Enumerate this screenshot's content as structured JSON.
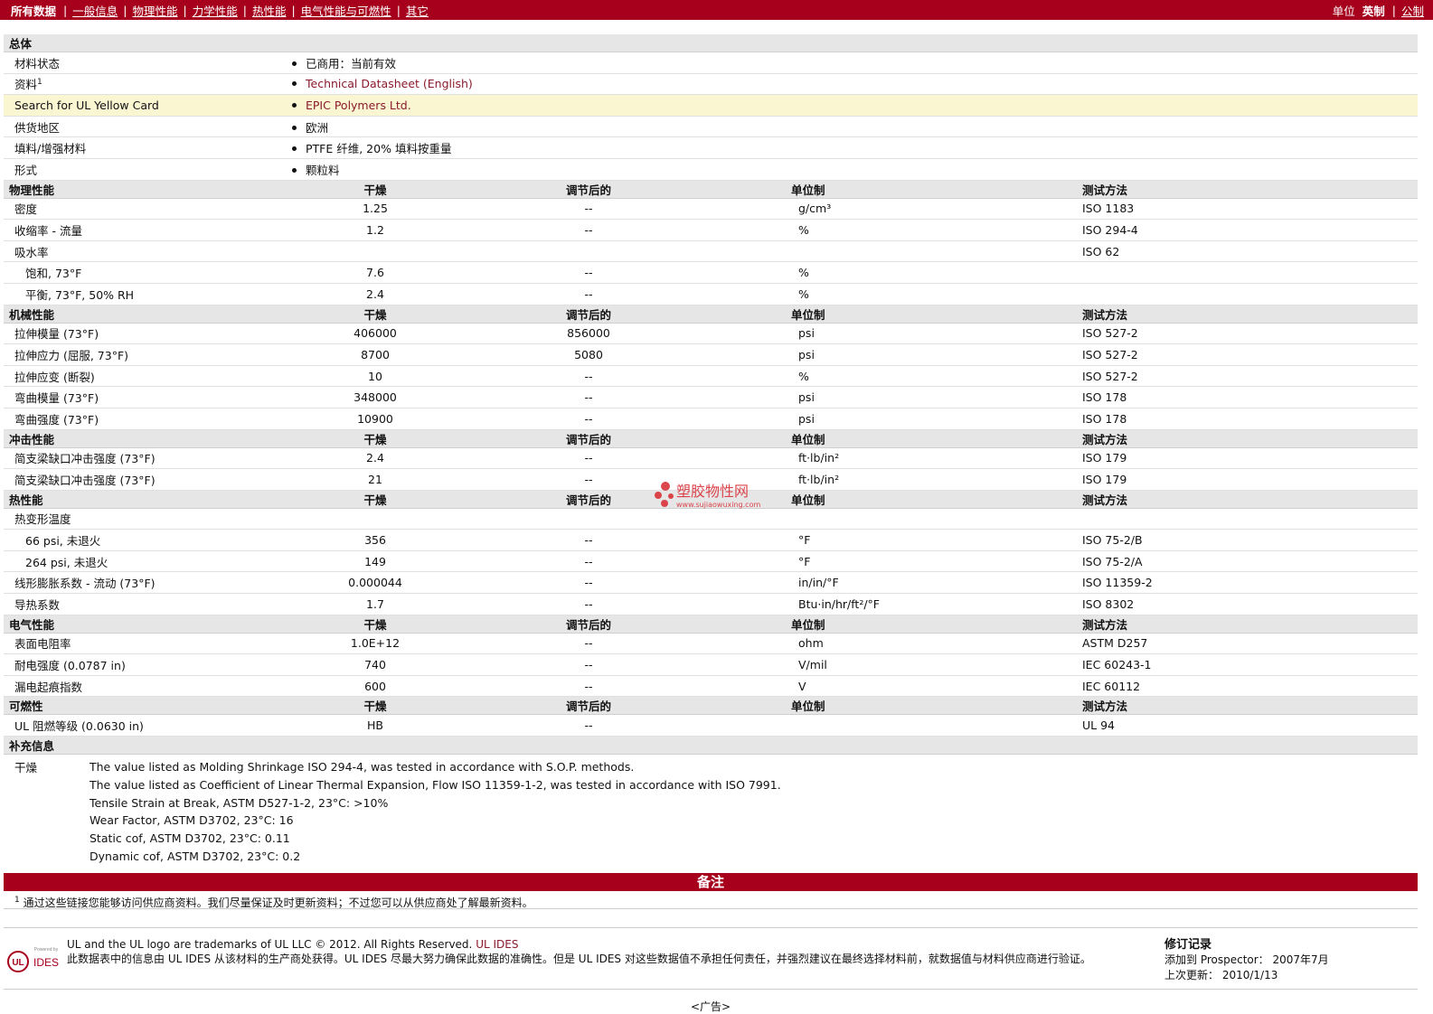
{
  "nav": {
    "current": "所有数据",
    "items": [
      "一般信息",
      "物理性能",
      "力学性能",
      "热性能",
      "电气性能与可燃性",
      "其它"
    ],
    "units_label": "单位",
    "unit_english": "英制",
    "unit_metric": "公制"
  },
  "general": {
    "title": "总体",
    "rows": [
      {
        "label": "材料状态",
        "value": "已商用：当前有效"
      },
      {
        "label": "资料",
        "value": "Technical Datasheet (English)"
      },
      {
        "label": "Search for UL Yellow Card",
        "value": "EPIC Polymers Ltd."
      },
      {
        "label": "供货地区",
        "value": "欧洲"
      },
      {
        "label": "填料/增强材料",
        "value": "PTFE 纤维, 20% 填料按重量"
      },
      {
        "label": "形式",
        "value": "颗粒料"
      }
    ],
    "sup": "1"
  },
  "headers": {
    "dry": "干燥",
    "cond": "调节后的",
    "unit": "单位制",
    "method": "测试方法"
  },
  "physical": {
    "title": "物理性能",
    "rows": [
      {
        "label": "密度",
        "dry": "1.25",
        "cond": "--",
        "unit": "g/cm³",
        "method": "ISO 1183"
      },
      {
        "label": "收缩率  - 流量",
        "dry": "1.2",
        "cond": "--",
        "unit": "%",
        "method": "ISO 294-4"
      },
      {
        "label": "吸水率",
        "dry": "",
        "cond": "",
        "unit": "",
        "method": "ISO 62"
      },
      {
        "label": "饱和, 73°F",
        "dry": "7.6",
        "cond": "--",
        "unit": "%",
        "method": ""
      },
      {
        "label": "平衡, 73°F, 50% RH",
        "dry": "2.4",
        "cond": "--",
        "unit": "%",
        "method": ""
      }
    ]
  },
  "mechanical": {
    "title": "机械性能",
    "rows": [
      {
        "label": "拉伸模量  (73°F)",
        "dry": "406000",
        "cond": "856000",
        "unit": "psi",
        "method": "ISO 527-2"
      },
      {
        "label": "拉伸应力  (屈服, 73°F)",
        "dry": "8700",
        "cond": "5080",
        "unit": "psi",
        "method": "ISO 527-2"
      },
      {
        "label": "拉伸应变  (断裂)",
        "dry": "10",
        "cond": "--",
        "unit": "%",
        "method": "ISO 527-2"
      },
      {
        "label": "弯曲模量  (73°F)",
        "dry": "348000",
        "cond": "--",
        "unit": "psi",
        "method": "ISO 178"
      },
      {
        "label": "弯曲强度  (73°F)",
        "dry": "10900",
        "cond": "--",
        "unit": "psi",
        "method": "ISO 178"
      }
    ]
  },
  "impact": {
    "title": "冲击性能",
    "rows": [
      {
        "label": "简支梁缺口冲击强度  (73°F)",
        "dry": "2.4",
        "cond": "--",
        "unit": "ft·lb/in²",
        "method": "ISO 179"
      },
      {
        "label": "简支梁缺口冲击强度  (73°F)",
        "dry": "21",
        "cond": "--",
        "unit": "ft·lb/in²",
        "method": "ISO 179"
      }
    ]
  },
  "thermal": {
    "title": "热性能",
    "rows": [
      {
        "label": "热变形温度",
        "dry": "",
        "cond": "",
        "unit": "",
        "method": ""
      },
      {
        "label": "66 psi, 未退火",
        "dry": "356",
        "cond": "--",
        "unit": "°F",
        "method": "ISO 75-2/B"
      },
      {
        "label": "264 psi, 未退火",
        "dry": "149",
        "cond": "--",
        "unit": "°F",
        "method": "ISO 75-2/A"
      },
      {
        "label": "线形膨胀系数  - 流动  (73°F)",
        "dry": "0.000044",
        "cond": "--",
        "unit": "in/in/°F",
        "method": "ISO 11359-2"
      },
      {
        "label": "导热系数",
        "dry": "1.7",
        "cond": "--",
        "unit": "Btu·in/hr/ft²/°F",
        "method": "ISO 8302"
      }
    ]
  },
  "electrical": {
    "title": "电气性能",
    "rows": [
      {
        "label": "表面电阻率",
        "dry": "1.0E+12",
        "cond": "--",
        "unit": "ohm",
        "method": "ASTM D257"
      },
      {
        "label": "耐电强度  (0.0787 in)",
        "dry": "740",
        "cond": "--",
        "unit": "V/mil",
        "method": "IEC 60243-1"
      },
      {
        "label": "漏电起痕指数",
        "dry": "600",
        "cond": "--",
        "unit": "V",
        "method": "IEC 60112"
      }
    ]
  },
  "flammability": {
    "title": "可燃性",
    "rows": [
      {
        "label": "UL 阻燃等级  (0.0630 in)",
        "dry": "HB",
        "cond": "--",
        "unit": "",
        "method": "UL 94"
      }
    ]
  },
  "supplementary": {
    "title": "补充信息",
    "key": "干燥",
    "lines": [
      "The value listed as Molding Shrinkage ISO 294-4, was tested in accordance with S.O.P. methods.",
      "The value listed as Coefficient of Linear Thermal Expansion, Flow ISO 11359-1-2, was tested in accordance with ISO 7991.",
      "Tensile Strain at Break, ASTM D527-1-2, 23°C: >10%",
      "Wear Factor, ASTM D3702, 23°C: 16",
      "Static cof, ASTM D3702, 23°C: 0.11",
      "Dynamic cof, ASTM D3702, 23°C: 0.2"
    ]
  },
  "notes": {
    "title": "备注",
    "sup": "1",
    "text": "通过这些链接您能够访问供应商资料。我们尽量保证及时更新资料；不过您可以从供应商处了解最新资料。"
  },
  "footer": {
    "logo_powered": "Powered by",
    "logo_ul": "UL",
    "logo_ides": "IDES",
    "line1": "UL and the UL logo are trademarks of UL LLC © 2012. All Rights Reserved.",
    "line1_link": "UL IDES",
    "line2": "此数据表中的信息由  UL IDES 从该材料的生产商处获得。UL IDES 尽最大努力确保此数据的准确性。但是  UL IDES 对这些数据值不承担任何责任，并强烈建议在最终选择材料前，就数据值与材料供应商进行验证。",
    "rev_title": "修订记录",
    "rev_added": "添加到  Prospector：   2007年7月",
    "rev_updated": "上次更新：   2010/1/13"
  },
  "ad": "<广告>",
  "watermark": {
    "name": "塑胶物性网",
    "url": "www.sujiaowuxing.com"
  }
}
